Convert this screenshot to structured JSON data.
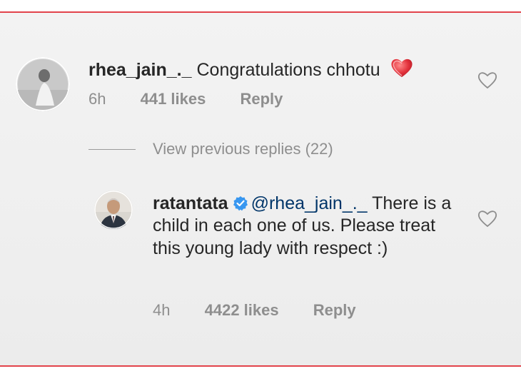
{
  "comments": [
    {
      "username": "rhea_jain_._",
      "text": "Congratulations chhotu",
      "emoji": "red-heart-emoji",
      "time": "6h",
      "likes": "441 likes",
      "reply_label": "Reply"
    }
  ],
  "replies_toggle": {
    "label": "View previous replies (22)"
  },
  "replies": [
    {
      "username": "ratantata",
      "verified": true,
      "mention": "@rhea_jain_._",
      "text": "There is a child in each one of us. Please treat this young lady with respect :)",
      "time": "4h",
      "likes": "4422 likes",
      "reply_label": "Reply"
    }
  ],
  "colors": {
    "frame": "#e2434b",
    "text": "#262626",
    "meta": "#8e8e8e",
    "mention": "#003569",
    "verified": "#3897f0"
  }
}
